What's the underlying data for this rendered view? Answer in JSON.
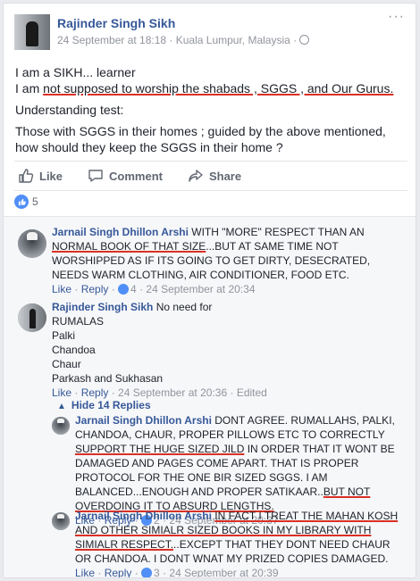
{
  "post": {
    "author": "Rajinder Singh Sikh",
    "meta": "24 September at 18:18 · Kuala Lumpur, Malaysia ·",
    "more": "···",
    "lines": [
      "I am a SIKH... learner",
      "I am ",
      "not supposed to worship the shabads , SGGS , and Our Gurus.",
      "Understanding test:",
      "Those with SGGS in their homes ; guided by the above mentioned, how should they keep the SGGS in their home ?"
    ]
  },
  "actions": {
    "like": "Like",
    "comment": "Comment",
    "share": "Share"
  },
  "reactions": {
    "count": "5"
  },
  "comments": [
    {
      "name": "Jarnail Singh Dhillon Arshi",
      "text_pre": " WITH \"MORE\" RESPECT THAN AN ",
      "text_ul": "NORMAL BOOK OF THAT SIZE",
      "text_post": "...BUT AT SAME TIME NOT WORSHIPPED AS IF ITS GOING TO GET DIRTY, DESECRATED, NEEDS WARM CLOTHING, AIR CONDITIONER, FOOD ETC.",
      "like": "Like",
      "reply": "Reply",
      "reacts": "4",
      "time": "24 September at 20:34"
    },
    {
      "name": "Rajinder Singh Sikh",
      "text": " No need for",
      "items": [
        "RUMALAS",
        "Palki",
        "Chandoa",
        "Chaur",
        "Parkash and Sukhasan"
      ],
      "like": "Like",
      "reply": "Reply",
      "time": "24 September at 20:36",
      "edited": "Edited"
    }
  ],
  "hide_replies": "Hide 14 Replies",
  "replies": [
    {
      "name": "Jarnail Singh Dhillon Arshi",
      "text_pre": " DONT AGREE. RUMALLAHS, PALKI, CHANDOA, CHAUR, PROPER PILLOWS ETC TO CORRECTLY ",
      "text_ul": "SUPPORT THE HUGE SIZED JILD",
      "text_mid": " IN ORDER THAT IT WONT BE DAMAGED AND PAGES COME APART. THAT IS PROPER PROTOCOL FOR THE ONE BIR SIZED SGGS. I AM BALANCED...ENOUGH AND PROPER SATIKAAR..",
      "text_ul2": "BUT NOT OVERDOING IT TO ABSURD LENGTHS.",
      "like": "Like",
      "reply": "Reply",
      "reacts": "2",
      "time": "24 September at 20:37"
    },
    {
      "name": "Jarnail Singh Dhillon Arshi",
      "text_ul": "IN FACT I TREAT THE MAHAN KOSH AND OTHER SIMIALR SIZED BOOKS IN MY LIBRARY WITH SIMIALR RESPECT.",
      "text_post": "..EXCEPT THAT THEY DONT NEED CHAUR OR CHANDOA. I DONT WNAT MY PRIZED COPIES DAMAGED.",
      "like": "Like",
      "reply": "Reply",
      "reacts": "3",
      "time": "24 September at 20:39"
    }
  ]
}
